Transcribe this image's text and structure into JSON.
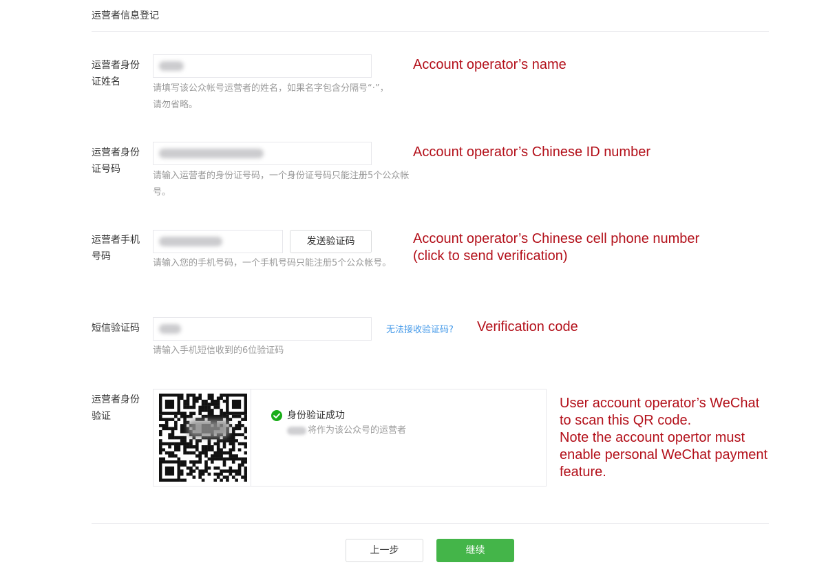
{
  "section_title": "运营者信息登记",
  "fields": {
    "id_name": {
      "label": "运营者身份证姓名",
      "hint": "请填写该公众帐号运营者的姓名，如果名字包含分隔号“·”，请勿省略。",
      "annotation": "Account operator’s name"
    },
    "id_number": {
      "label": "运营者身份证号码",
      "hint": "请输入运营者的身份证号码，一个身份证号码只能注册5个公众帐号。",
      "annotation": "Account operator’s Chinese ID number"
    },
    "phone": {
      "label": "运营者手机号码",
      "button": "发送验证码",
      "hint": "请输入您的手机号码，一个手机号码只能注册5个公众帐号。",
      "annotation_line1": "Account operator’s Chinese cell phone number",
      "annotation_line2": "(click to send verification)"
    },
    "sms_code": {
      "label": "短信验证码",
      "link": "无法接收验证码?",
      "hint": "请输入手机短信收到的6位验证码",
      "annotation": "Verification code"
    },
    "identity": {
      "label": "运营者身份验证",
      "status": "身份验证成功",
      "note": "将作为该公众号的运营者",
      "annotation_lines": [
        "User account operator’s WeChat",
        "to scan this QR code.",
        "Note the account opertor must",
        "enable personal WeChat payment",
        "feature."
      ]
    }
  },
  "footer": {
    "prev_button": "上一步",
    "next_button": "继续"
  },
  "colors": {
    "annotation": "#b3101a",
    "primary_green": "#44b549",
    "link_blue": "#459ae9",
    "success_green": "#1aad19"
  },
  "icons": {
    "success": "check-circle-icon",
    "qr": "qr-code-icon"
  }
}
